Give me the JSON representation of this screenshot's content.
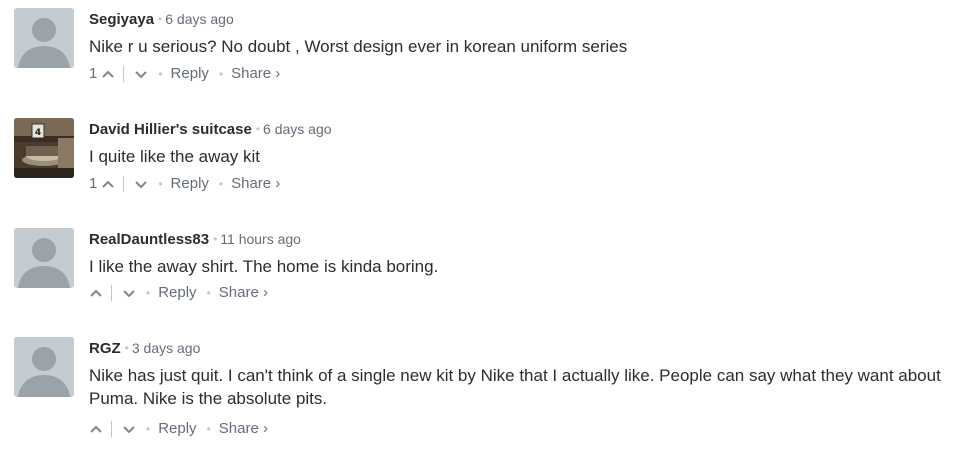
{
  "comments": [
    {
      "author": "Segiyaya",
      "time": "6 days ago",
      "text": "Nike r u serious? No doubt , Worst design ever in korean uniform series",
      "votes": "1",
      "reply_label": "Reply",
      "share_label": "Share ›"
    },
    {
      "author": "David Hillier's suitcase",
      "time": "6 days ago",
      "text": "I quite like the away kit",
      "votes": "1",
      "reply_label": "Reply",
      "share_label": "Share ›",
      "avatar_number": "4"
    },
    {
      "author": "RealDauntless83",
      "time": "11 hours ago",
      "text": "I like the away shirt. The home is kinda boring.",
      "votes": "",
      "reply_label": "Reply",
      "share_label": "Share ›"
    },
    {
      "author": "RGZ",
      "time": "3 days ago",
      "text": "Nike has just quit. I can't think of a single new kit by Nike that I actually like. People can say what they want about Puma. Nike is the absolute pits.",
      "votes": "",
      "reply_label": "Reply",
      "share_label": "Share ›"
    }
  ],
  "icons": {
    "upvote": "chevron-up-icon",
    "downvote": "chevron-down-icon",
    "avatar": "default-avatar-icon"
  },
  "colors": {
    "text": "#2a2e2e",
    "muted": "#656c7a",
    "divider": "#c2c6cc",
    "avatar_bg": "#c4ccd2",
    "avatar_fg": "#9aa3aa"
  }
}
